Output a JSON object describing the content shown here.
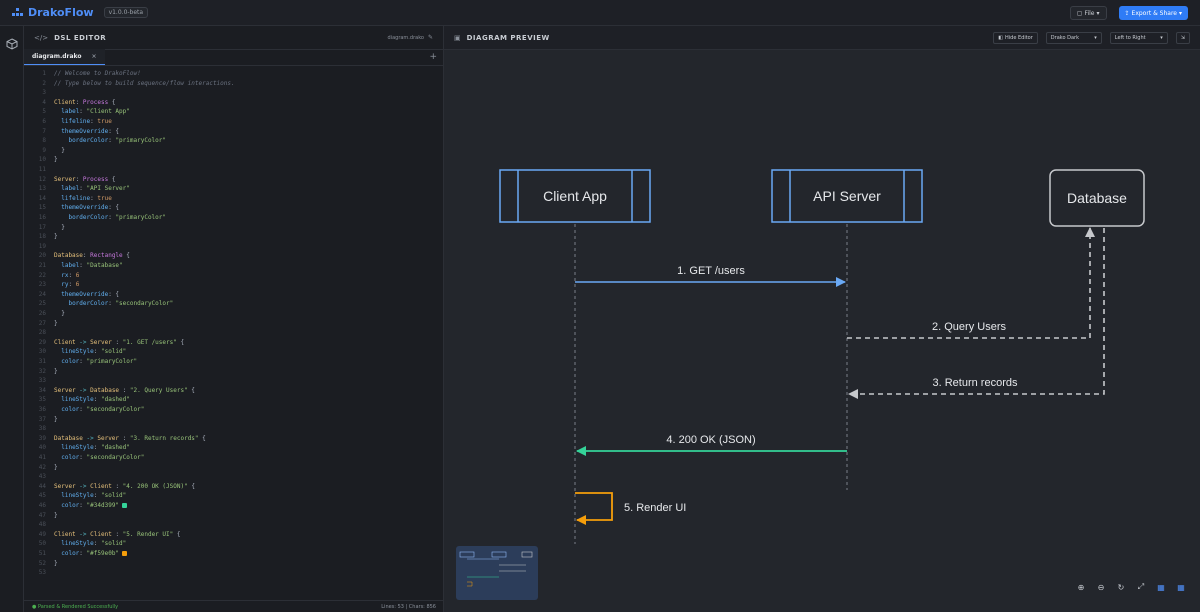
{
  "header": {
    "app_name": "DrakoFlow",
    "version": "v1.0.0-beta",
    "file_button": "File",
    "export_button": "Export & Share"
  },
  "editor": {
    "title": "DSL EDITOR",
    "file_name": "diagram.drako",
    "tab_label": "diagram.drako",
    "status_left": "Parsed & Rendered Successfully",
    "status_right": "Lines: 53 | Chars: 856",
    "lines": [
      [
        [
          "c-com",
          "// Welcome to DrakoFlow!"
        ]
      ],
      [
        [
          "c-com",
          "// Type below to build sequence/flow interactions."
        ]
      ],
      [],
      [
        [
          "c-ent",
          "Client"
        ],
        [
          "c-pun",
          ": "
        ],
        [
          "c-kw",
          "Process"
        ],
        [
          "c-pun",
          " {"
        ]
      ],
      [
        [
          "c-pun",
          "  "
        ],
        [
          "c-prop",
          "label"
        ],
        [
          "c-pun",
          ": "
        ],
        [
          "c-str",
          "\"Client App\""
        ]
      ],
      [
        [
          "c-pun",
          "  "
        ],
        [
          "c-prop",
          "lifeline"
        ],
        [
          "c-pun",
          ": "
        ],
        [
          "c-num",
          "true"
        ]
      ],
      [
        [
          "c-pun",
          "  "
        ],
        [
          "c-prop",
          "themeOverride"
        ],
        [
          "c-pun",
          ": {"
        ]
      ],
      [
        [
          "c-pun",
          "    "
        ],
        [
          "c-prop",
          "borderColor"
        ],
        [
          "c-pun",
          ": "
        ],
        [
          "c-str",
          "\"primaryColor\""
        ]
      ],
      [
        [
          "c-pun",
          "  }"
        ]
      ],
      [
        [
          "c-pun",
          "}"
        ]
      ],
      [],
      [
        [
          "c-ent",
          "Server"
        ],
        [
          "c-pun",
          ": "
        ],
        [
          "c-kw",
          "Process"
        ],
        [
          "c-pun",
          " {"
        ]
      ],
      [
        [
          "c-pun",
          "  "
        ],
        [
          "c-prop",
          "label"
        ],
        [
          "c-pun",
          ": "
        ],
        [
          "c-str",
          "\"API Server\""
        ]
      ],
      [
        [
          "c-pun",
          "  "
        ],
        [
          "c-prop",
          "lifeline"
        ],
        [
          "c-pun",
          ": "
        ],
        [
          "c-num",
          "true"
        ]
      ],
      [
        [
          "c-pun",
          "  "
        ],
        [
          "c-prop",
          "themeOverride"
        ],
        [
          "c-pun",
          ": {"
        ]
      ],
      [
        [
          "c-pun",
          "    "
        ],
        [
          "c-prop",
          "borderColor"
        ],
        [
          "c-pun",
          ": "
        ],
        [
          "c-str",
          "\"primaryColor\""
        ]
      ],
      [
        [
          "c-pun",
          "  }"
        ]
      ],
      [
        [
          "c-pun",
          "}"
        ]
      ],
      [],
      [
        [
          "c-ent",
          "Database"
        ],
        [
          "c-pun",
          ": "
        ],
        [
          "c-kw",
          "Rectangle"
        ],
        [
          "c-pun",
          " {"
        ]
      ],
      [
        [
          "c-pun",
          "  "
        ],
        [
          "c-prop",
          "label"
        ],
        [
          "c-pun",
          ": "
        ],
        [
          "c-str",
          "\"Database\""
        ]
      ],
      [
        [
          "c-pun",
          "  "
        ],
        [
          "c-prop",
          "rx"
        ],
        [
          "c-pun",
          ": "
        ],
        [
          "c-num",
          "6"
        ]
      ],
      [
        [
          "c-pun",
          "  "
        ],
        [
          "c-prop",
          "ry"
        ],
        [
          "c-pun",
          ": "
        ],
        [
          "c-num",
          "6"
        ]
      ],
      [
        [
          "c-pun",
          "  "
        ],
        [
          "c-prop",
          "themeOverride"
        ],
        [
          "c-pun",
          ": {"
        ]
      ],
      [
        [
          "c-pun",
          "    "
        ],
        [
          "c-prop",
          "borderColor"
        ],
        [
          "c-pun",
          ": "
        ],
        [
          "c-str",
          "\"secondaryColor\""
        ]
      ],
      [
        [
          "c-pun",
          "  }"
        ]
      ],
      [
        [
          "c-pun",
          "}"
        ]
      ],
      [],
      [
        [
          "c-ent",
          "Client"
        ],
        [
          "c-arr",
          " -> "
        ],
        [
          "c-ent",
          "Server"
        ],
        [
          "c-pun",
          " : "
        ],
        [
          "c-str",
          "\"1. GET /users\""
        ],
        [
          "c-pun",
          " {"
        ]
      ],
      [
        [
          "c-pun",
          "  "
        ],
        [
          "c-prop",
          "lineStyle"
        ],
        [
          "c-pun",
          ": "
        ],
        [
          "c-str",
          "\"solid\""
        ]
      ],
      [
        [
          "c-pun",
          "  "
        ],
        [
          "c-prop",
          "color"
        ],
        [
          "c-pun",
          ": "
        ],
        [
          "c-str",
          "\"primaryColor\""
        ]
      ],
      [
        [
          "c-pun",
          "}"
        ]
      ],
      [],
      [
        [
          "c-ent",
          "Server"
        ],
        [
          "c-arr",
          " -> "
        ],
        [
          "c-ent",
          "Database"
        ],
        [
          "c-pun",
          " : "
        ],
        [
          "c-str",
          "\"2. Query Users\""
        ],
        [
          "c-pun",
          " {"
        ]
      ],
      [
        [
          "c-pun",
          "  "
        ],
        [
          "c-prop",
          "lineStyle"
        ],
        [
          "c-pun",
          ": "
        ],
        [
          "c-str",
          "\"dashed\""
        ]
      ],
      [
        [
          "c-pun",
          "  "
        ],
        [
          "c-prop",
          "color"
        ],
        [
          "c-pun",
          ": "
        ],
        [
          "c-str",
          "\"secondaryColor\""
        ]
      ],
      [
        [
          "c-pun",
          "}"
        ]
      ],
      [],
      [
        [
          "c-ent",
          "Database"
        ],
        [
          "c-arr",
          " -> "
        ],
        [
          "c-ent",
          "Server"
        ],
        [
          "c-pun",
          " : "
        ],
        [
          "c-str",
          "\"3. Return records\""
        ],
        [
          "c-pun",
          " {"
        ]
      ],
      [
        [
          "c-pun",
          "  "
        ],
        [
          "c-prop",
          "lineStyle"
        ],
        [
          "c-pun",
          ": "
        ],
        [
          "c-str",
          "\"dashed\""
        ]
      ],
      [
        [
          "c-pun",
          "  "
        ],
        [
          "c-prop",
          "color"
        ],
        [
          "c-pun",
          ": "
        ],
        [
          "c-str",
          "\"secondaryColor\""
        ]
      ],
      [
        [
          "c-pun",
          "}"
        ]
      ],
      [],
      [
        [
          "c-ent",
          "Server"
        ],
        [
          "c-arr",
          " -> "
        ],
        [
          "c-ent",
          "Client"
        ],
        [
          "c-pun",
          " : "
        ],
        [
          "c-str",
          "\"4. 200 OK (JSON)\""
        ],
        [
          "c-pun",
          " {"
        ]
      ],
      [
        [
          "c-pun",
          "  "
        ],
        [
          "c-prop",
          "lineStyle"
        ],
        [
          "c-pun",
          ": "
        ],
        [
          "c-str",
          "\"solid\""
        ]
      ],
      [
        [
          "c-pun",
          "  "
        ],
        [
          "c-prop",
          "color"
        ],
        [
          "c-pun",
          ": "
        ],
        [
          "c-str",
          "\"#34d399\""
        ],
        [
          "swatch",
          "#34d399"
        ]
      ],
      [
        [
          "c-pun",
          "}"
        ]
      ],
      [],
      [
        [
          "c-ent",
          "Client"
        ],
        [
          "c-arr",
          " -> "
        ],
        [
          "c-ent",
          "Client"
        ],
        [
          "c-pun",
          " : "
        ],
        [
          "c-str",
          "\"5. Render UI\""
        ],
        [
          "c-pun",
          " {"
        ]
      ],
      [
        [
          "c-pun",
          "  "
        ],
        [
          "c-prop",
          "lineStyle"
        ],
        [
          "c-pun",
          ": "
        ],
        [
          "c-str",
          "\"solid\""
        ]
      ],
      [
        [
          "c-pun",
          "  "
        ],
        [
          "c-prop",
          "color"
        ],
        [
          "c-pun",
          ": "
        ],
        [
          "c-str",
          "\"#f59e0b\""
        ],
        [
          "swatch",
          "#f59e0b"
        ]
      ],
      [
        [
          "c-pun",
          "}"
        ]
      ],
      []
    ]
  },
  "preview": {
    "title": "DIAGRAM PREVIEW",
    "hide_editor": "Hide Editor",
    "theme": "Drako Dark",
    "direction": "Left to Right",
    "participants": {
      "client": "Client App",
      "server": "API Server",
      "database": "Database"
    },
    "messages": {
      "m1": "1. GET /users",
      "m2": "2. Query Users",
      "m3": "3. Return records",
      "m4": "4. 200 OK (JSON)",
      "m5": "5. Render UI"
    },
    "colors": {
      "primary": "#6aa9f5",
      "secondary": "#c6c8cc",
      "success": "#34d399",
      "warning": "#f59e0b",
      "accent": "#2f7cf6"
    }
  }
}
